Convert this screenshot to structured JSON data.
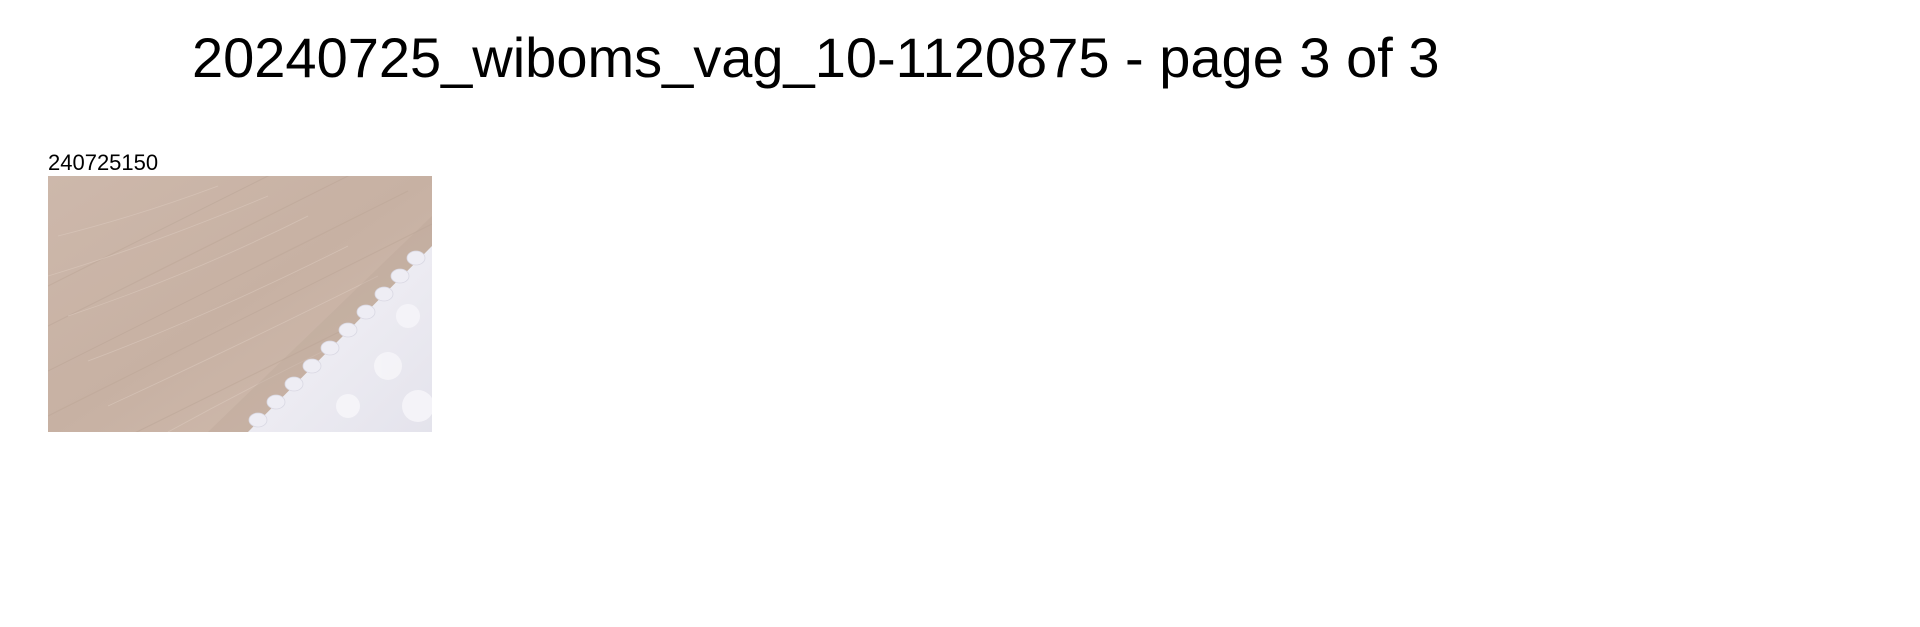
{
  "page": {
    "title": "20240725_wiboms_vag_10-1120875 - page 3 of 3"
  },
  "gallery": {
    "items": [
      {
        "label": "240725150",
        "image_subject": "wood-floor-with-white-fringed-rug-edge"
      }
    ]
  },
  "colors": {
    "background": "#ffffff",
    "text": "#000000",
    "wood": "#c9b3a5",
    "rug": "#f2f1f6"
  }
}
